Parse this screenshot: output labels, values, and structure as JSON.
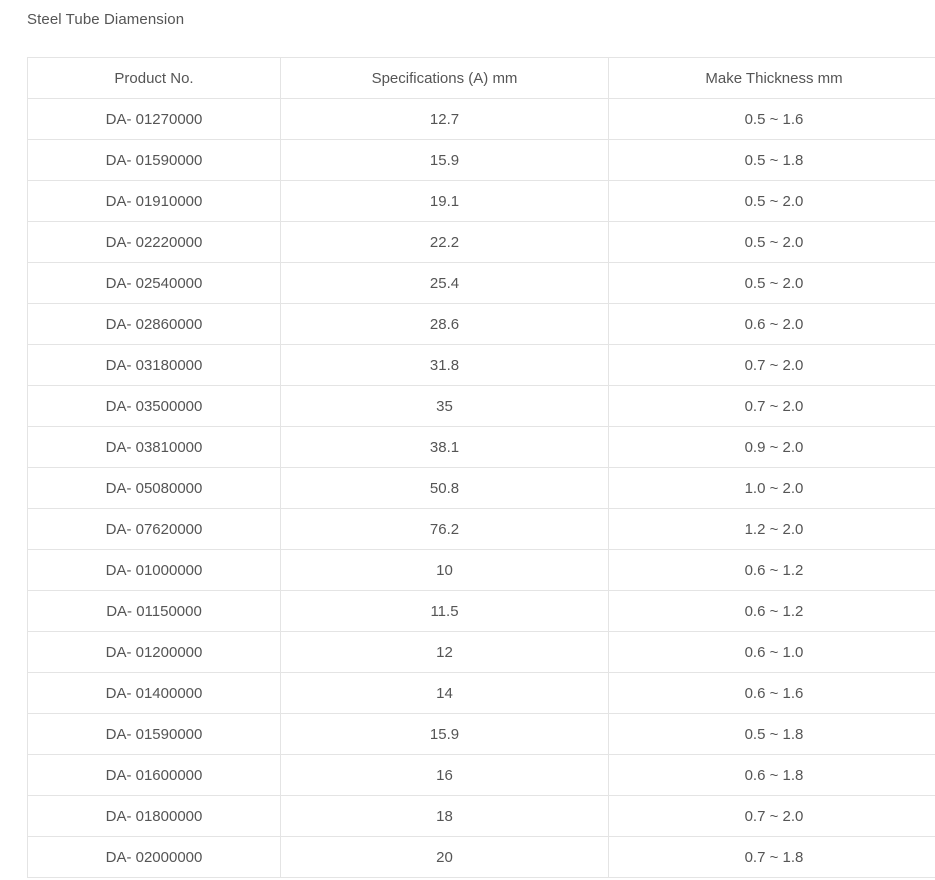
{
  "page": {
    "title": "Steel Tube Diamension"
  },
  "table": {
    "headers": [
      "Product No.",
      "Specifications (A) mm",
      "Make Thickness mm"
    ],
    "rows": [
      [
        "DA- 01270000",
        "12.7",
        "0.5 ~ 1.6"
      ],
      [
        "DA- 01590000",
        "15.9",
        "0.5 ~ 1.8"
      ],
      [
        "DA- 01910000",
        "19.1",
        "0.5 ~ 2.0"
      ],
      [
        "DA- 02220000",
        "22.2",
        "0.5 ~ 2.0"
      ],
      [
        "DA- 02540000",
        "25.4",
        "0.5 ~ 2.0"
      ],
      [
        "DA- 02860000",
        "28.6",
        "0.6 ~ 2.0"
      ],
      [
        "DA- 03180000",
        "31.8",
        "0.7 ~ 2.0"
      ],
      [
        "DA- 03500000",
        "35",
        "0.7 ~ 2.0"
      ],
      [
        "DA- 03810000",
        "38.1",
        "0.9 ~ 2.0"
      ],
      [
        "DA- 05080000",
        "50.8",
        "1.0 ~ 2.0"
      ],
      [
        "DA- 07620000",
        "76.2",
        "1.2 ~ 2.0"
      ],
      [
        "DA- 01000000",
        "10",
        "0.6 ~ 1.2"
      ],
      [
        "DA- 01150000",
        "11.5",
        "0.6 ~ 1.2"
      ],
      [
        "DA- 01200000",
        "12",
        "0.6 ~ 1.0"
      ],
      [
        "DA- 01400000",
        "14",
        "0.6 ~ 1.6"
      ],
      [
        "DA- 01590000",
        "15.9",
        "0.5 ~ 1.8"
      ],
      [
        "DA- 01600000",
        "16",
        "0.6 ~ 1.8"
      ],
      [
        "DA- 01800000",
        "18",
        "0.7 ~ 2.0"
      ],
      [
        "DA- 02000000",
        "20",
        "0.7 ~ 1.8"
      ]
    ]
  }
}
